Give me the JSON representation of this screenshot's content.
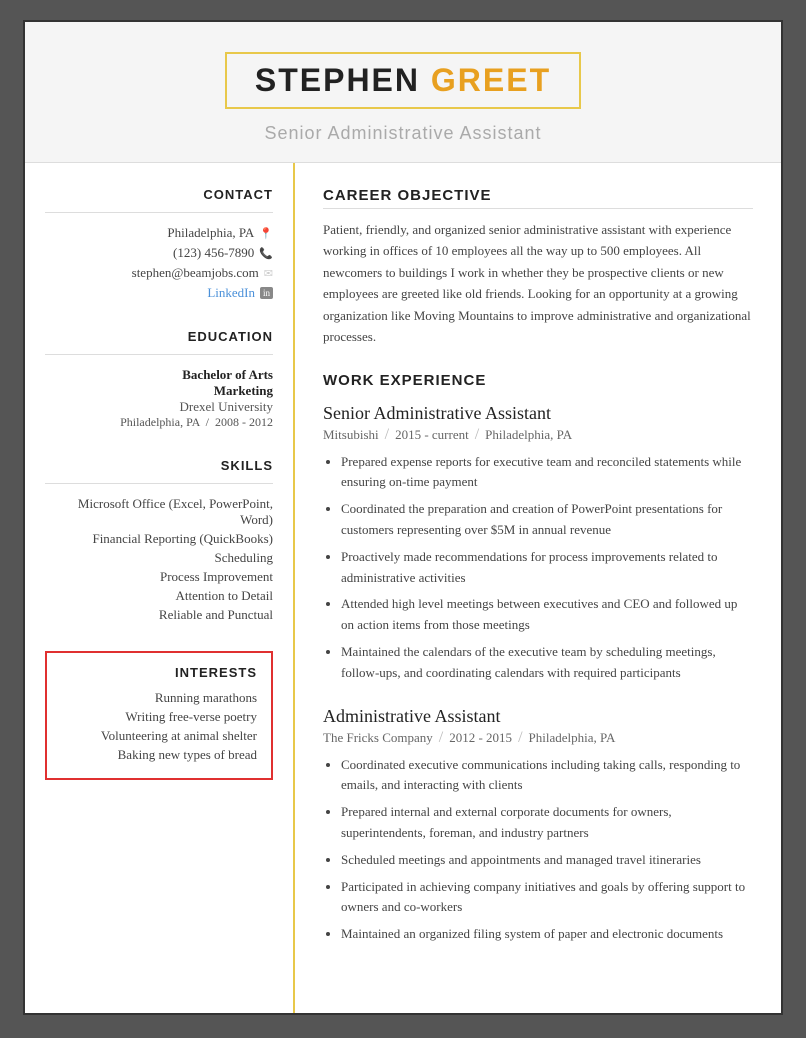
{
  "header": {
    "first_name": "STEPHEN",
    "last_name": "GREET",
    "title": "Senior Administrative Assistant"
  },
  "sidebar": {
    "contact_title": "CONTACT",
    "contact_location": "Philadelphia, PA",
    "contact_phone": "(123) 456-7890",
    "contact_email": "stephen@beamjobs.com",
    "contact_linkedin_label": "LinkedIn",
    "education_title": "EDUCATION",
    "edu_degree": "Bachelor of Arts",
    "edu_major": "Marketing",
    "edu_school": "Drexel University",
    "edu_location": "Philadelphia, PA",
    "edu_slash": "/",
    "edu_years": "2008 - 2012",
    "skills_title": "SKILLS",
    "skills": [
      "Microsoft Office (Excel, PowerPoint, Word)",
      "Financial Reporting (QuickBooks)",
      "Scheduling",
      "Process Improvement",
      "Attention to Detail",
      "Reliable and Punctual"
    ],
    "interests_title": "INTERESTS",
    "interests": [
      "Running marathons",
      "Writing free-verse poetry",
      "Volunteering at animal shelter",
      "Baking new types of bread"
    ]
  },
  "main": {
    "career_objective_title": "CAREER OBJECTIVE",
    "career_objective_text": "Patient, friendly, and organized senior administrative assistant with experience working in offices of 10 employees all the way up to 500 employees. All newcomers to buildings I work in whether they be prospective clients or new employees are greeted like old friends. Looking for an opportunity at a growing organization like Moving Mountains to improve administrative and organizational processes.",
    "work_experience_title": "WORK EXPERIENCE",
    "jobs": [
      {
        "title": "Senior Administrative Assistant",
        "company": "Mitsubishi",
        "period": "2015 - current",
        "location": "Philadelphia, PA",
        "bullets": [
          "Prepared expense reports for executive team and reconciled statements while ensuring on-time payment",
          "Coordinated the preparation and creation of PowerPoint presentations for customers representing over $5M in annual revenue",
          "Proactively made recommendations for process improvements related to administrative activities",
          "Attended high level meetings between executives and CEO and followed up on action items from those meetings",
          "Maintained the calendars of the executive team by scheduling meetings, follow-ups, and coordinating calendars with required participants"
        ]
      },
      {
        "title": "Administrative Assistant",
        "company": "The Fricks Company",
        "period": "2012 - 2015",
        "location": "Philadelphia, PA",
        "bullets": [
          "Coordinated executive communications including taking calls, responding to emails, and interacting with clients",
          "Prepared internal and external corporate documents for owners, superintendents, foreman, and industry partners",
          "Scheduled meetings and appointments and managed travel itineraries",
          "Participated in achieving company initiatives and goals by offering support to owners and co-workers",
          "Maintained an organized filing system of paper and electronic documents"
        ]
      }
    ]
  },
  "icons": {
    "location": "📍",
    "phone": "📞",
    "email": "✉",
    "linkedin": "in"
  }
}
